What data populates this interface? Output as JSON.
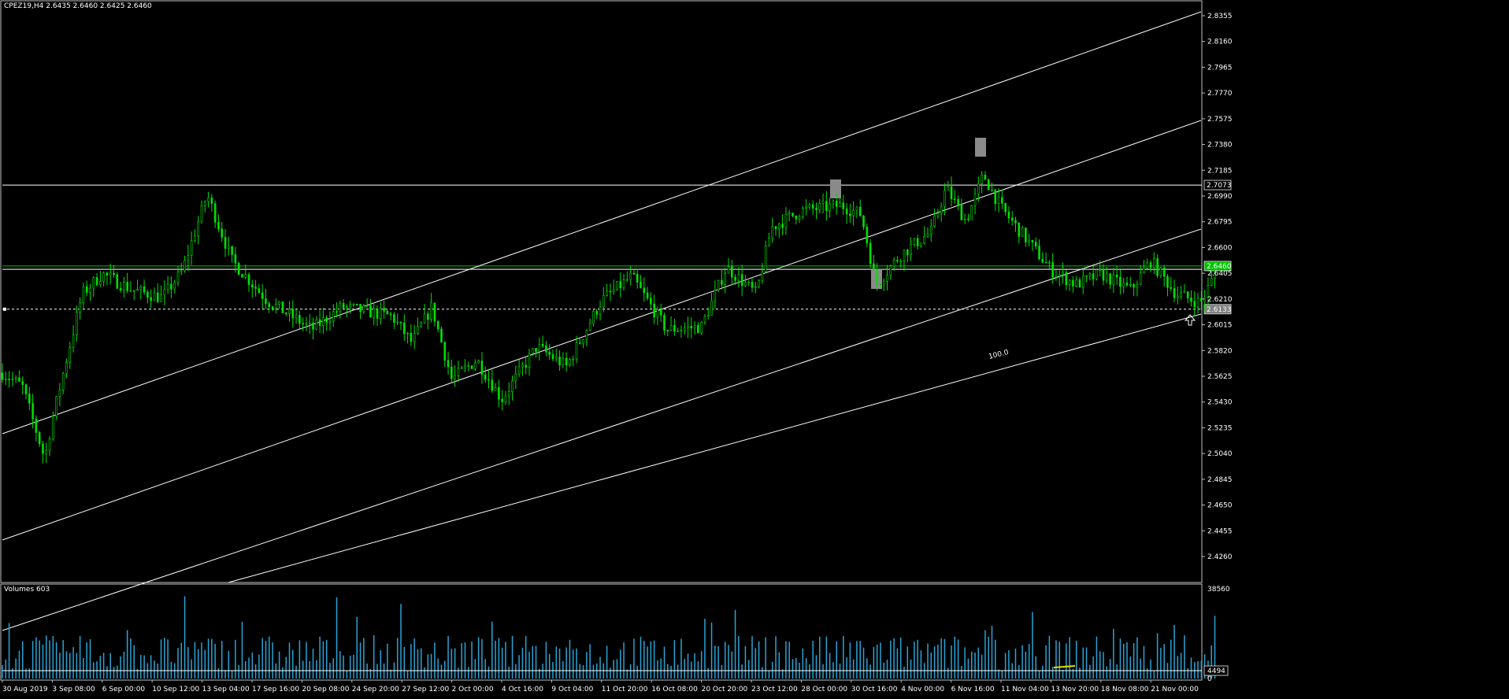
{
  "info": {
    "symbol_line": "CPEZ19,H4  2.6435 2.6460 2.6425 2.6460"
  },
  "volume_info": {
    "label": "Volumes 603"
  },
  "chart_data": {
    "type": "candlestick",
    "symbol": "CPEZ19",
    "timeframe": "H4",
    "ohlc_display": {
      "open": 2.6435,
      "high": 2.646,
      "low": 2.6425,
      "close": 2.646
    },
    "price_axis": {
      "ylim": [
        4.2095,
        2.8435
      ],
      "ticks": [
        "2.8355",
        "2.8160",
        "2.7965",
        "2.7770",
        "2.7575",
        "2.7380",
        "2.7185",
        "2.6990",
        "2.6795",
        "2.6600",
        "2.6405",
        "2.6210",
        "2.6015",
        "2.5820",
        "2.5625",
        "2.5430",
        "2.5235",
        "2.5040",
        "2.4845",
        "2.4650",
        "2.4455",
        "2.4260"
      ]
    },
    "volume_axis": {
      "max_label": "38560",
      "current_label": "4494",
      "zero_label": "0"
    },
    "x_labels": [
      "30 Aug 2019",
      "3 Sep 08:00",
      "6 Sep 00:00",
      "10 Sep 12:00",
      "13 Sep 04:00",
      "17 Sep 16:00",
      "20 Sep 08:00",
      "24 Sep 20:00",
      "27 Sep 12:00",
      "2 Oct 00:00",
      "4 Oct 16:00",
      "9 Oct 04:00",
      "11 Oct 20:00",
      "16 Oct 08:00",
      "20 Oct 20:00",
      "23 Oct 12:00",
      "28 Oct 00:00",
      "30 Oct 16:00",
      "4 Nov 00:00",
      "6 Nov 16:00",
      "11 Nov 04:00",
      "13 Nov 20:00",
      "18 Nov 08:00",
      "21 Nov 00:00"
    ],
    "price_path_anchors": [
      {
        "x_label_index": 0,
        "close": 2.565
      },
      {
        "x_label_index": 0.4,
        "close": 2.555
      },
      {
        "x_label_index": 0.85,
        "close": 2.5
      },
      {
        "x_label_index": 1.0,
        "close": 2.53
      },
      {
        "x_label_index": 1.6,
        "close": 2.625
      },
      {
        "x_label_index": 2.0,
        "close": 2.64
      },
      {
        "x_label_index": 2.6,
        "close": 2.628
      },
      {
        "x_label_index": 3.2,
        "close": 2.622
      },
      {
        "x_label_index": 3.6,
        "close": 2.642
      },
      {
        "x_label_index": 4.1,
        "close": 2.7
      },
      {
        "x_label_index": 4.6,
        "close": 2.65
      },
      {
        "x_label_index": 5.3,
        "close": 2.62
      },
      {
        "x_label_index": 6.2,
        "close": 2.598
      },
      {
        "x_label_index": 6.8,
        "close": 2.615
      },
      {
        "x_label_index": 7.8,
        "close": 2.608
      },
      {
        "x_label_index": 8.2,
        "close": 2.588
      },
      {
        "x_label_index": 8.6,
        "close": 2.615
      },
      {
        "x_label_index": 9.0,
        "close": 2.56
      },
      {
        "x_label_index": 9.5,
        "close": 2.575
      },
      {
        "x_label_index": 10.0,
        "close": 2.545
      },
      {
        "x_label_index": 10.7,
        "close": 2.585
      },
      {
        "x_label_index": 11.3,
        "close": 2.57
      },
      {
        "x_label_index": 12.0,
        "close": 2.62
      },
      {
        "x_label_index": 12.6,
        "close": 2.638
      },
      {
        "x_label_index": 13.3,
        "close": 2.598
      },
      {
        "x_label_index": 14.0,
        "close": 2.6
      },
      {
        "x_label_index": 14.5,
        "close": 2.645
      },
      {
        "x_label_index": 15.1,
        "close": 2.625
      },
      {
        "x_label_index": 15.4,
        "close": 2.675
      },
      {
        "x_label_index": 16.0,
        "close": 2.688
      },
      {
        "x_label_index": 16.8,
        "close": 2.692
      },
      {
        "x_label_index": 17.2,
        "close": 2.685
      },
      {
        "x_label_index": 17.5,
        "close": 2.632
      },
      {
        "x_label_index": 18.0,
        "close": 2.655
      },
      {
        "x_label_index": 18.6,
        "close": 2.672
      },
      {
        "x_label_index": 18.9,
        "close": 2.705
      },
      {
        "x_label_index": 19.3,
        "close": 2.68
      },
      {
        "x_label_index": 19.65,
        "close": 2.715
      },
      {
        "x_label_index": 20.0,
        "close": 2.69
      },
      {
        "x_label_index": 20.6,
        "close": 2.662
      },
      {
        "x_label_index": 21.0,
        "close": 2.643
      },
      {
        "x_label_index": 21.5,
        "close": 2.632
      },
      {
        "x_label_index": 22.0,
        "close": 2.64
      },
      {
        "x_label_index": 22.6,
        "close": 2.628
      },
      {
        "x_label_index": 23.0,
        "close": 2.65
      },
      {
        "x_label_index": 23.5,
        "close": 2.625
      },
      {
        "x_label_index": 24.0,
        "close": 2.618
      },
      {
        "x_label_index": 24.35,
        "close": 2.645
      }
    ],
    "horizontal_levels": [
      {
        "price": 2.7073,
        "label": "2.7073",
        "color": "#ffffff",
        "style": "solid"
      },
      {
        "price": 2.646,
        "label": "2.6460",
        "color": "#00c000",
        "style": "solid"
      },
      {
        "price": 2.6435,
        "label": "",
        "color": "#ffffff",
        "style": "solid"
      },
      {
        "price": 2.6133,
        "label": "2.6133",
        "color": "#ffffff",
        "style": "dashed"
      }
    ],
    "channel_label": "100.0",
    "colors": {
      "bull": "#00e000",
      "bear": "#00e000",
      "volume": "#29a3d6",
      "background": "#000000",
      "level_green": "#00c000"
    }
  }
}
